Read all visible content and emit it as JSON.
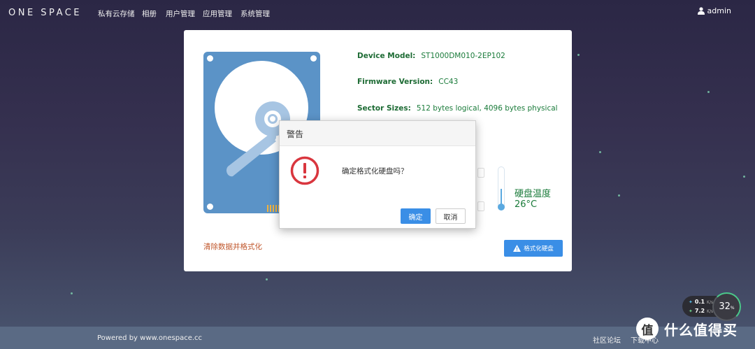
{
  "app": {
    "logo": "ONE SPACE",
    "nav": [
      "私有云存储",
      "相册",
      "用户管理",
      "应用管理",
      "系统管理"
    ],
    "user": "admin"
  },
  "disk_info": {
    "device_model_label": "Device Model:",
    "device_model_value": "ST1000DM010-2EP102",
    "firmware_label": "Firmware Version:",
    "firmware_value": "CC43",
    "sector_label": "Sector Sizes:",
    "sector_value": "512 bytes logical, 4096 bytes physical",
    "temp_label": "硬盘温度",
    "temp_value": "26°C",
    "temp_level": 0.45,
    "erase_text": "清除数据并格式化",
    "format_button": "格式化硬盘"
  },
  "dialog": {
    "title": "警告",
    "message": "确定格式化硬盘吗？",
    "ok": "确定",
    "cancel": "取消"
  },
  "speed_widget": {
    "up": "0.1",
    "up_unit": "K/s",
    "down": "7.2",
    "down_unit": "K/s",
    "percent": "32",
    "percent_unit": "%"
  },
  "footer": {
    "powered": "Powered by www.onespace.cc",
    "links": [
      "社区论坛",
      "下载中心"
    ]
  },
  "watermark": {
    "icon": "值",
    "text": "什么值得买"
  },
  "colors": {
    "accent": "#3a8ee6",
    "info_green": "#1a7b3a",
    "disk_blue": "#5b93c7",
    "warn_red": "#d9363e"
  }
}
